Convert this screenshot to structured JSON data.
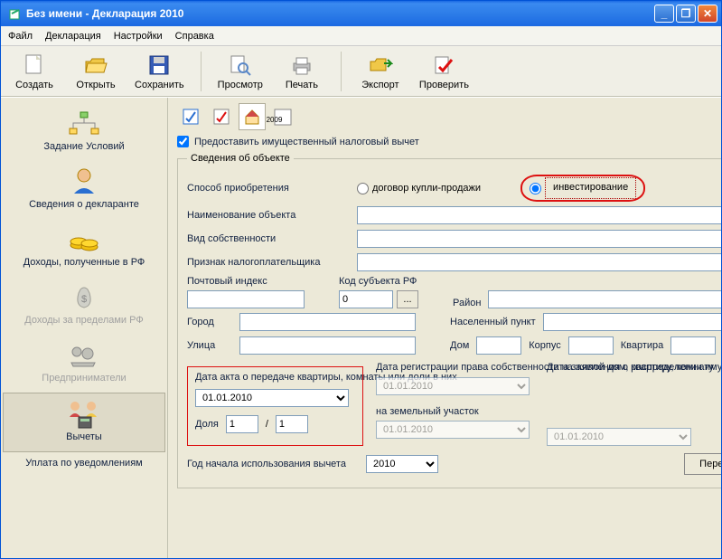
{
  "window": {
    "title": "Без имени - Декларация 2010"
  },
  "menu": {
    "file": "Файл",
    "declaration": "Декларация",
    "settings": "Настройки",
    "help": "Справка"
  },
  "toolbar": {
    "create": "Создать",
    "open": "Открыть",
    "save": "Сохранить",
    "preview": "Просмотр",
    "print": "Печать",
    "export": "Экспорт",
    "check": "Проверить"
  },
  "sidebar": {
    "conditions": "Задание Условий",
    "declarant": "Сведения о декларанте",
    "income_rf": "Доходы, полученные в РФ",
    "income_abroad": "Доходы за пределами РФ",
    "entrepreneurs": "Предприниматели",
    "deductions": "Вычеты",
    "notices": "Уплата по уведомлениям"
  },
  "content": {
    "tab_year": "2009",
    "provide_chk": "Предоставить имущественный налоговый вычет",
    "object_legend": "Сведения об объекте",
    "acq_label": "Способ приобретения",
    "radio_contract": "договор купли-продажи",
    "radio_invest": "инвестирование",
    "name_label": "Наименование объекта",
    "own_label": "Вид собственности",
    "taxpayer_label": "Признак налогоплательщика",
    "zip_label": "Почтовый индекс",
    "region_code_label": "Код субъекта РФ",
    "region_code_value": "0",
    "region_label": "Район",
    "city_label": "Город",
    "settlement_label": "Населенный пункт",
    "street_label": "Улица",
    "house_label": "Дом",
    "building_label": "Корпус",
    "apt_label": "Квартира",
    "date_act_label": "Дата акта о передаче квартиры, комнаты или доли в них",
    "date_act_value": "01.01.2010",
    "share_label": "Доля",
    "share_num": "1",
    "share_den": "1",
    "share_slash": "/",
    "date_reg_label": "Дата регистрации права собственности на жилой дом, квартиру, комнату",
    "date_reg_value": "01.01.2010",
    "date_land_label": "на земельный участок",
    "date_land_value": "01.01.2010",
    "date_app_label": "Дата заявления о распределении имущественного вычета",
    "date_app_value": "01.01.2010",
    "year_use_label": "Год начала использования вычета",
    "year_use_value": "2010",
    "goto_sums": "Перейти к вводу сумм",
    "dots": "..."
  }
}
